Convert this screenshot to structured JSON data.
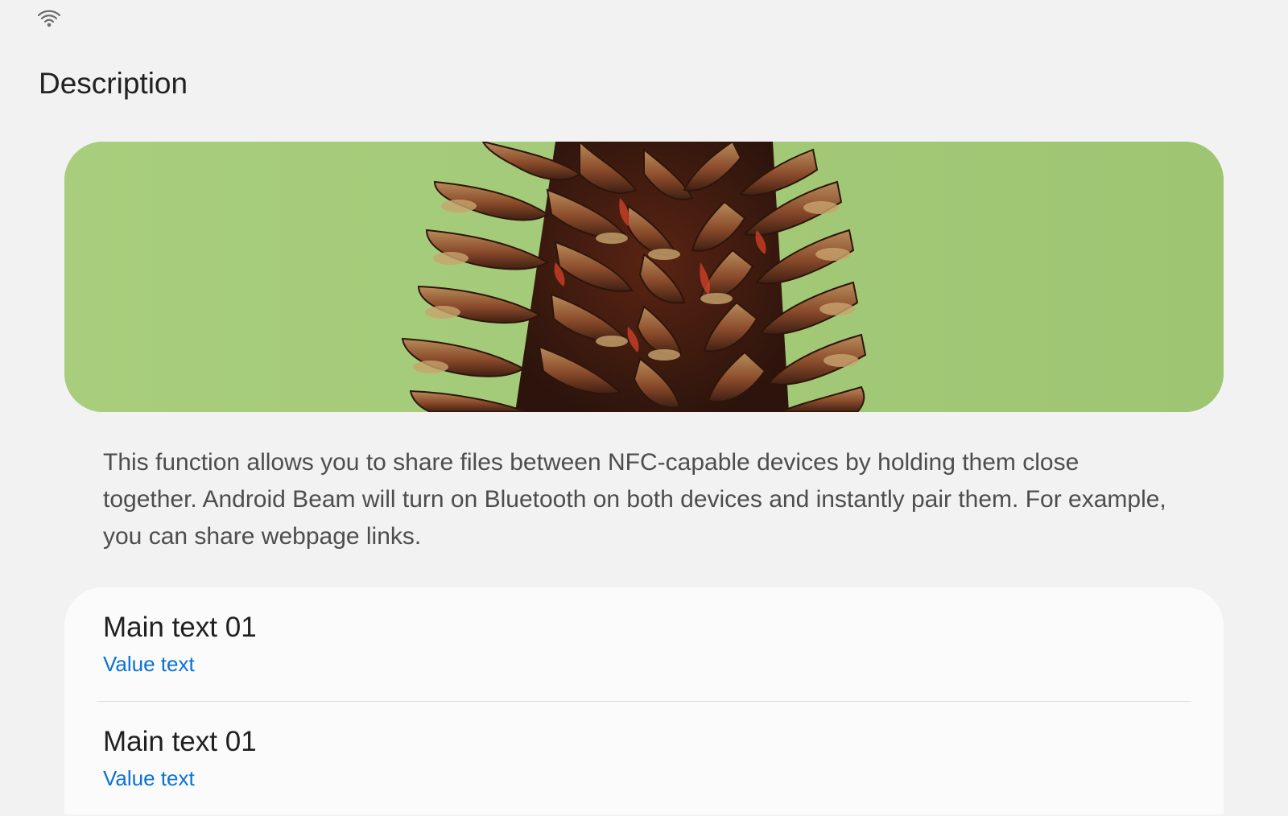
{
  "status_bar": {
    "wifi_icon": "wifi-icon"
  },
  "page": {
    "title": "Description"
  },
  "hero": {
    "image": "pinecone-image",
    "background_color": "#a4cb7a"
  },
  "description": {
    "text": "This function allows you to share files between NFC-capable devices by holding them close together. Android Beam will  turn on Bluetooth on both devices and instantly pair them. For example, you can share webpage links."
  },
  "list": {
    "items": [
      {
        "main": "Main text 01",
        "value": "Value text"
      },
      {
        "main": "Main text 01",
        "value": "Value text"
      }
    ]
  },
  "colors": {
    "accent": "#0a72d3",
    "background": "#f2f2f2",
    "card": "#fbfbfb"
  }
}
